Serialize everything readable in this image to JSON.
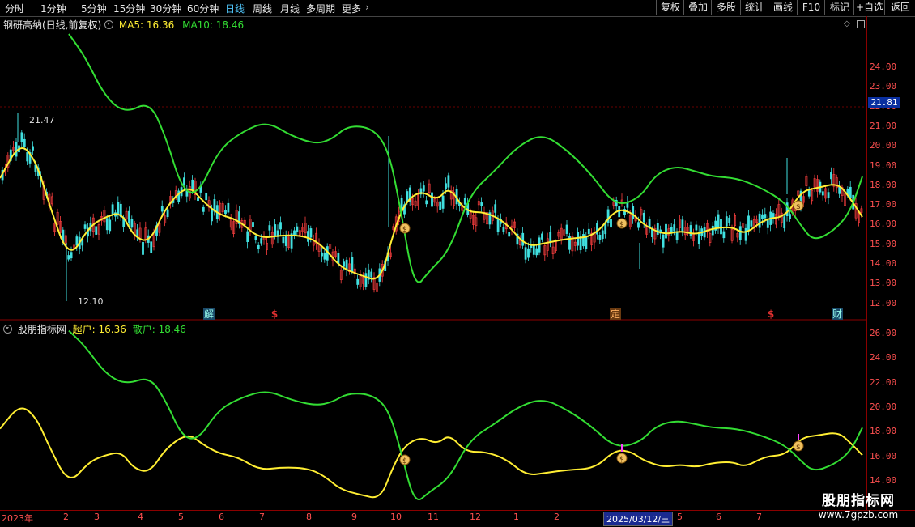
{
  "toolbar": {
    "periods": [
      "分时",
      "1分钟",
      "5分钟",
      "15分钟",
      "30分钟",
      "60分钟",
      "日线",
      "周线",
      "月线",
      "多周期",
      "更多"
    ],
    "active_period": "日线",
    "buttons": [
      "复权",
      "叠加",
      "多股",
      "统计",
      "画线",
      "F10",
      "标记",
      "+自选",
      "返回"
    ]
  },
  "main_panel": {
    "stock_name": "钢研高纳(日线,前复权)",
    "ma5_label": "MA5: 16.36",
    "ma10_label": "MA10: 18.46",
    "current_price": "21.81",
    "high_annotation": "21.47",
    "low_annotation": "12.10",
    "axis_ticks": [
      "24.00",
      "23.00",
      "22.00",
      "21.00",
      "20.00",
      "19.00",
      "18.00",
      "17.00",
      "16.00",
      "15.00",
      "14.00",
      "13.00",
      "12.00"
    ],
    "events": [
      {
        "type": "jie",
        "label": "解"
      },
      {
        "type": "dollar",
        "label": "$"
      },
      {
        "type": "ding",
        "label": "定"
      },
      {
        "type": "dollar",
        "label": "$"
      },
      {
        "type": "cai",
        "label": "财"
      }
    ]
  },
  "sub_panel": {
    "indicator_name": "股朋指标网",
    "super_label": "超户: 16.36",
    "retail_label": "散户: 18.46",
    "axis_ticks": [
      "26.00",
      "24.00",
      "22.00",
      "20.00",
      "18.00",
      "16.00",
      "14.00"
    ]
  },
  "date_axis": {
    "labels": [
      "2023年",
      "2",
      "3",
      "4",
      "5",
      "6",
      "7",
      "8",
      "9",
      "10",
      "11",
      "12",
      "1",
      "2",
      "2025/03/12/三",
      "5",
      "6",
      "7"
    ],
    "selected": "2025/03/12/三"
  },
  "watermark": {
    "title": "股朋指标网",
    "url": "www.7gpzb.com"
  },
  "colors": {
    "ma5": "#ffee33",
    "ma10": "#33dd33",
    "up": "#ff4040",
    "down": "#40e0e0",
    "axis": "#ff5050"
  }
}
